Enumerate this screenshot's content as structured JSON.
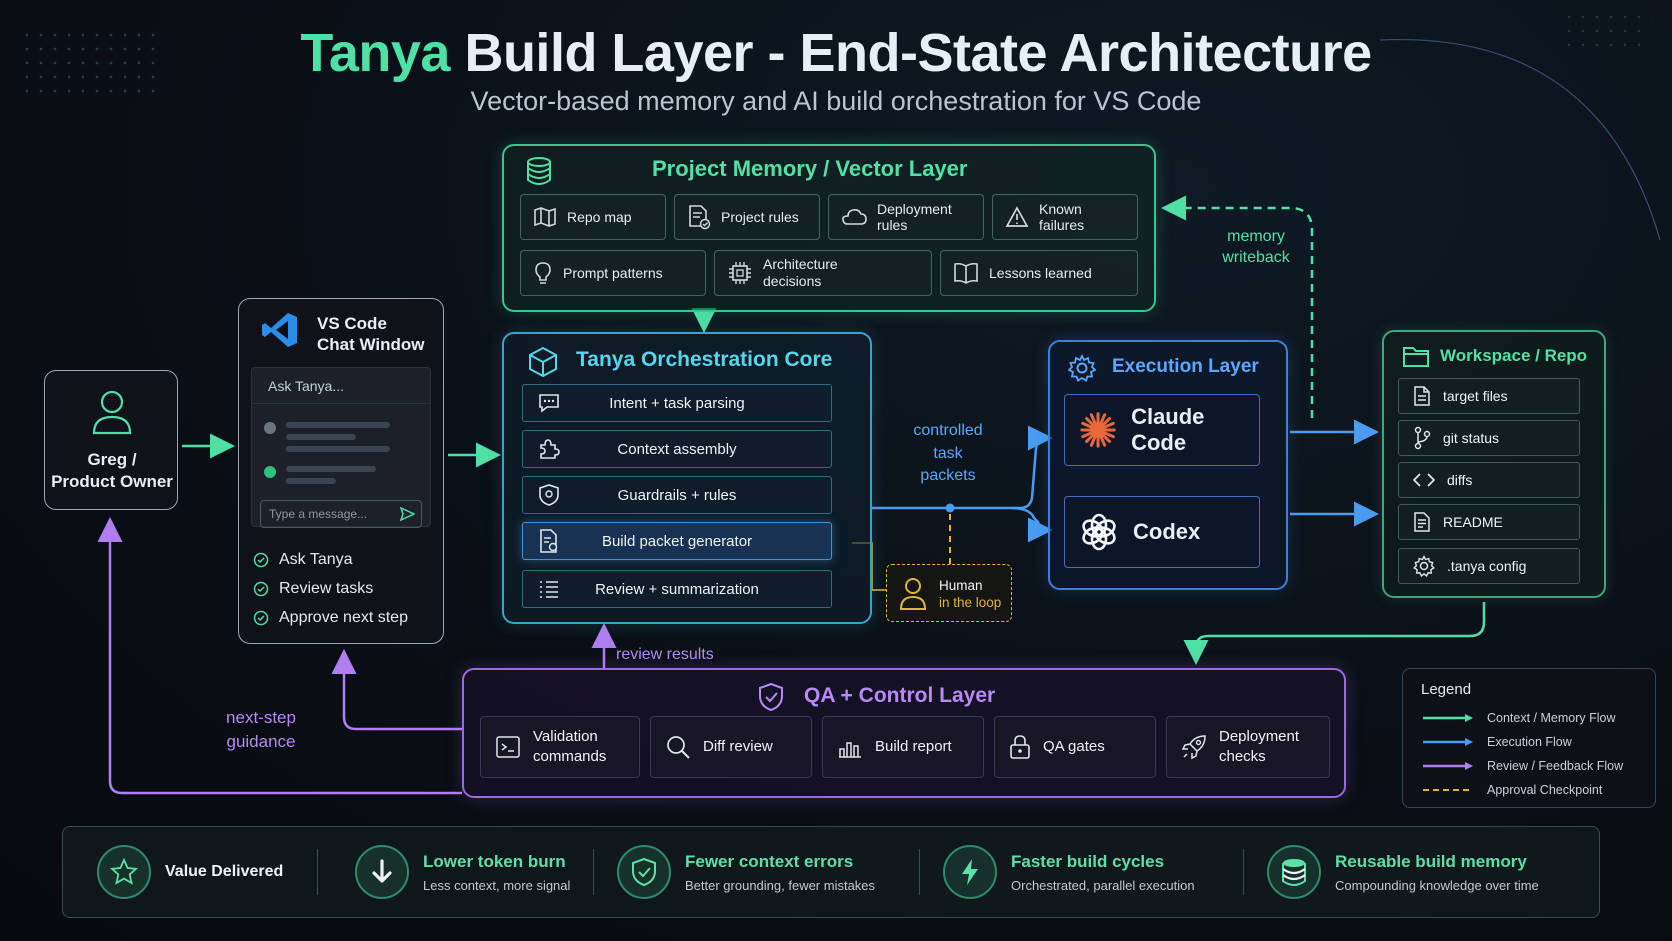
{
  "title": {
    "accent": "Tanya",
    "rest": "Build Layer - End-State Architecture"
  },
  "subtitle": "Vector-based memory and AI build orchestration for VS Code",
  "memory": {
    "heading": "Project Memory / Vector Layer",
    "items": [
      "Repo map",
      "Project rules",
      "Deployment rules",
      "Known failures",
      "Prompt patterns",
      "Architecture decisions",
      "Lessons learned"
    ],
    "arch_line1": "Architecture",
    "arch_line2": "decisions"
  },
  "owner": {
    "line1": "Greg /",
    "line2": "Product Owner"
  },
  "vscode": {
    "title_line1": "VS Code",
    "title_line2": "Chat Window",
    "ask_placeholder": "Ask Tanya...",
    "input_placeholder": "Type a message...",
    "checks": [
      "Ask Tanya",
      "Review tasks",
      "Approve next step"
    ]
  },
  "core": {
    "heading": "Tanya Orchestration Core",
    "rows": [
      "Intent + task parsing",
      "Context assembly",
      "Guardrails + rules",
      "Build packet generator",
      "Review + summarization"
    ]
  },
  "execution": {
    "heading": "Execution Layer",
    "engines": [
      "Claude Code",
      "Codex"
    ]
  },
  "workspace": {
    "heading": "Workspace / Repo",
    "items": [
      "target files",
      "git status",
      "diffs",
      "README",
      ".tanya config"
    ]
  },
  "human": {
    "line1": "Human",
    "line2": "in the loop"
  },
  "labels": {
    "controlled": [
      "controlled",
      "task",
      "packets"
    ],
    "memory_writeback": [
      "memory",
      "writeback"
    ],
    "review_results": "review results",
    "next_step": [
      "next-step",
      "guidance"
    ]
  },
  "qa": {
    "heading": "QA + Control Layer",
    "items": [
      {
        "l1": "Validation",
        "l2": "commands"
      },
      {
        "l1": "Diff review",
        "l2": ""
      },
      {
        "l1": "Build report",
        "l2": ""
      },
      {
        "l1": "QA gates",
        "l2": ""
      },
      {
        "l1": "Deployment",
        "l2": "checks"
      }
    ]
  },
  "legend": {
    "title": "Legend",
    "items": [
      "Context / Memory Flow",
      "Execution Flow",
      "Review / Feedback Flow",
      "Approval Checkpoint"
    ]
  },
  "value": {
    "label": "Value Delivered",
    "items": [
      {
        "title": "Lower token burn",
        "sub": "Less context, more signal"
      },
      {
        "title": "Fewer context errors",
        "sub": "Better grounding, fewer mistakes"
      },
      {
        "title": "Faster build cycles",
        "sub": "Orchestrated, parallel execution"
      },
      {
        "title": "Reusable build memory",
        "sub": "Compounding knowledge over time"
      }
    ]
  },
  "colors": {
    "context_flow": "#4fe0a6",
    "execution_flow": "#4a9cf0",
    "feedback_flow": "#b07ef0",
    "approval": "#e0b43a"
  }
}
